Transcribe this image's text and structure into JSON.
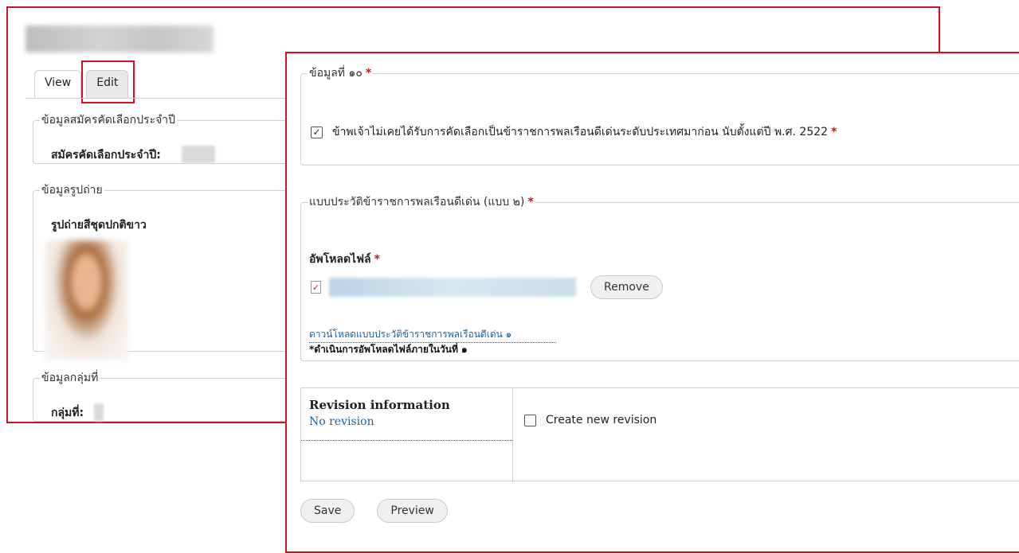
{
  "back": {
    "tabs": {
      "view": "View",
      "edit": "Edit"
    },
    "section1": {
      "legend": "ข้อมูลสมัครคัดเลือกประจำปี",
      "label": "สมัครคัดเลือกประจำปี:"
    },
    "section2": {
      "legend": "ข้อมูลรูปถ่าย",
      "label": "รูปถ่ายสีชุดปกติขาว"
    },
    "section3": {
      "legend": "ข้อมูลกลุ่มที่",
      "label": "กลุ่มที่:"
    }
  },
  "front": {
    "section10": {
      "legend": "ข้อมูลที่ ๑๐",
      "required_mark": "*",
      "checkbox_label": "ข้าพเจ้าไม่เคยได้รับการคัดเลือกเป็นข้าราชการพลเรือนดีเด่นระดับประเทศมาก่อน นับตั้งแต่ปี พ.ศ. 2522",
      "checked": true
    },
    "form2": {
      "legend": "แบบประวัติข้าราชการพลเรือนดีเด่น (แบบ ๒)",
      "required_mark": "*",
      "upload_label": "อัพโหลดไฟล์",
      "remove_button": "Remove",
      "download_link": "ดาวน์โหลดแบบประวัติข้าราชการพลเรือนดีเด่น ๑",
      "note": "*ดำเนินการอัพโหลดไฟล์ภายในวันที่ ๑"
    },
    "revision": {
      "title": "Revision information",
      "subtitle": "No revision",
      "checkbox_label": "Create new revision",
      "checked": false
    },
    "actions": {
      "save": "Save",
      "preview": "Preview"
    }
  },
  "colors": {
    "highlight": "#d40f1e",
    "link": "#1a63a8",
    "required": "#d40f1e"
  }
}
